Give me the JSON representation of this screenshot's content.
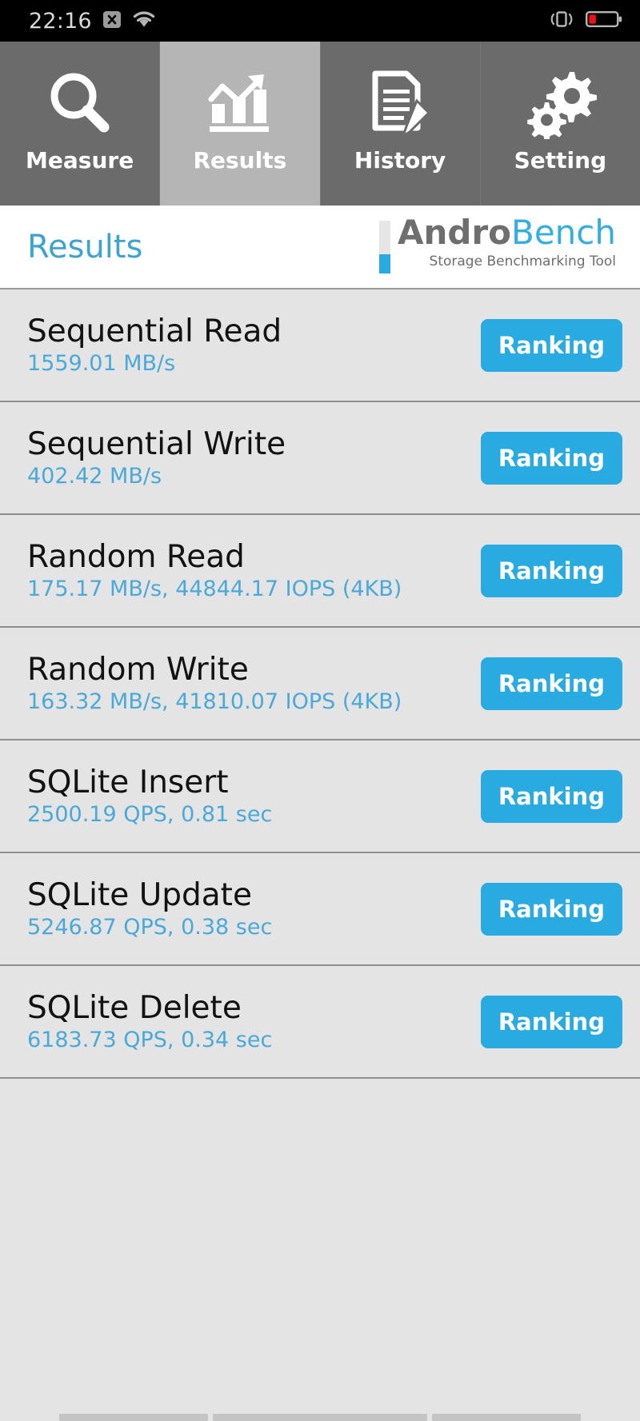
{
  "statusbar": {
    "clock": "22:16",
    "icons_left": [
      "sim-no-service-icon",
      "wifi-icon"
    ],
    "icons_right": [
      "vibrate-icon",
      "battery-low-icon"
    ],
    "battery_color": "#ee1111",
    "text_color": "#d8d8d8",
    "background": "#000000"
  },
  "tabs": [
    {
      "label": "Measure",
      "icon": "magnifier-icon",
      "active": false
    },
    {
      "label": "Results",
      "icon": "bar-chart-icon",
      "active": true
    },
    {
      "label": "History",
      "icon": "document-pencil-icon",
      "active": false
    },
    {
      "label": "Setting",
      "icon": "gears-icon",
      "active": false
    }
  ],
  "header": {
    "page_title": "Results",
    "logo": {
      "word_first": "Andro",
      "word_second": "Bench",
      "tagline": "Storage Benchmarking Tool",
      "color_first": "#6e6e6e",
      "color_second": "#34ade0"
    }
  },
  "results": {
    "ranking_label": "Ranking",
    "accent_color": "#29abe2",
    "value_color": "#4aa9d8",
    "rows": [
      {
        "name": "Sequential Read",
        "value": "1559.01 MB/s"
      },
      {
        "name": "Sequential Write",
        "value": "402.42 MB/s"
      },
      {
        "name": "Random Read",
        "value": "175.17 MB/s, 44844.17 IOPS (4KB)"
      },
      {
        "name": "Random Write",
        "value": "163.32 MB/s, 41810.07 IOPS (4KB)"
      },
      {
        "name": "SQLite Insert",
        "value": "2500.19 QPS, 0.81 sec"
      },
      {
        "name": "SQLite Update",
        "value": "5246.87 QPS, 0.38 sec"
      },
      {
        "name": "SQLite Delete",
        "value": "6183.73 QPS, 0.34 sec"
      }
    ]
  },
  "navbar": {
    "items": [
      "back-pill",
      "home-pill",
      "recents-pill"
    ]
  }
}
